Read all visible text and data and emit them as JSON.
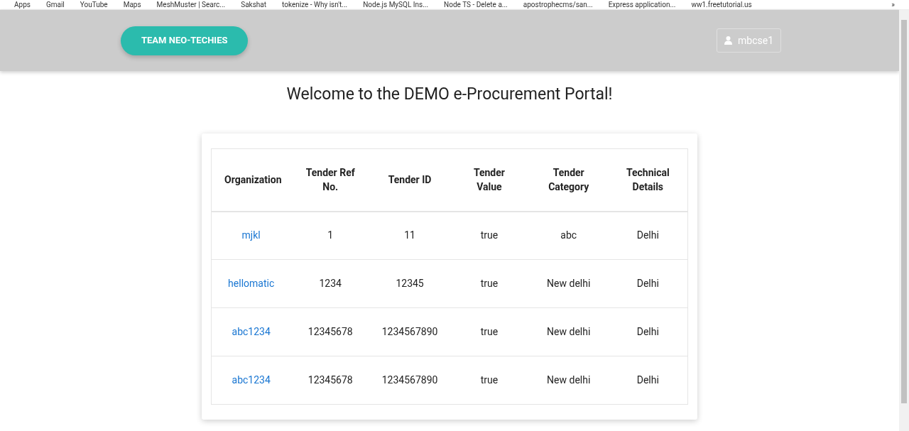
{
  "bookmarks_bar": {
    "items": [
      "Apps",
      "Gmail",
      "YouTube",
      "Maps",
      "MeshMuster | Searc...",
      "Sakshat",
      "tokenize - Why isn't...",
      "Node.js MySQL Ins...",
      "Node TS - Delete a...",
      "apostrophecms/san...",
      "Express application...",
      "ww1.freetutorial.us"
    ],
    "overflow": "»"
  },
  "header": {
    "brand": "TEAM NEO-TECHIES",
    "user": "mbcse1"
  },
  "title": "Welcome to the DEMO e-Procurement Portal!",
  "table": {
    "columns": [
      "Organization",
      "Tender Ref No.",
      "Tender ID",
      "Tender Value",
      "Tender Category",
      "Technical Details"
    ],
    "rows": [
      [
        "mjkl",
        "1",
        "11",
        "true",
        "abc",
        "Delhi"
      ],
      [
        "hellomatic",
        "1234",
        "12345",
        "true",
        "New delhi",
        "Delhi"
      ],
      [
        "abc1234",
        "12345678",
        "1234567890",
        "true",
        "New delhi",
        "Delhi"
      ],
      [
        "abc1234",
        "12345678",
        "1234567890",
        "true",
        "New delhi",
        "Delhi"
      ]
    ]
  }
}
